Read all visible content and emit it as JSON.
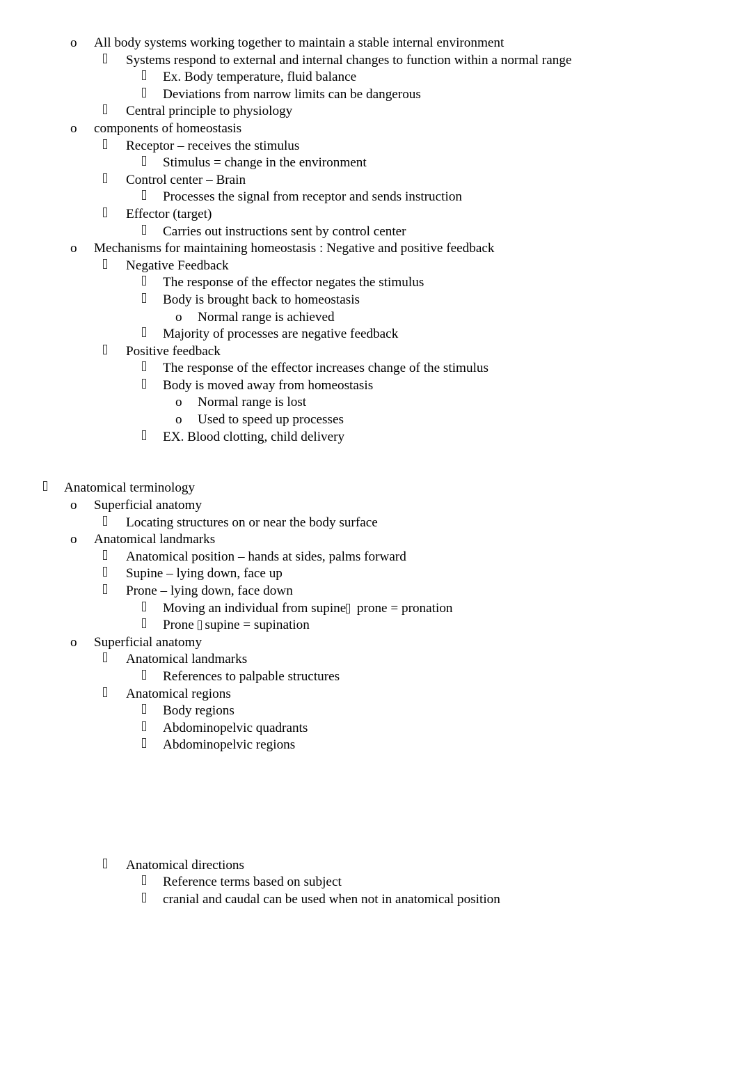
{
  "document": {
    "title": "Anatomy Notes — Homeostasis and Anatomical Terminology",
    "bullet_glyphs": {
      "level_o": "o",
      "level_tofu": "missing-glyph-box"
    },
    "colors": {
      "text": "#000000",
      "page_background": "#ffffff",
      "tofu_outline": "#3a3a3a"
    }
  },
  "blocks": [
    {
      "id": "homeostasis",
      "lines": [
        {
          "level": 1,
          "marker": "o",
          "text": "All body systems working together to maintain a stable internal environment"
        },
        {
          "level": 2,
          "marker": "tofu",
          "text": "Systems respond to external and internal changes to function within a normal range"
        },
        {
          "level": 3,
          "marker": "tofu",
          "text": "Ex. Body temperature, fluid balance"
        },
        {
          "level": 3,
          "marker": "tofu",
          "text": "Deviations from narrow limits can be dangerous"
        },
        {
          "level": 2,
          "marker": "tofu",
          "text": "Central principle to physiology"
        },
        {
          "level": 1,
          "marker": "o",
          "text": "components of homeostasis"
        },
        {
          "level": 2,
          "marker": "tofu",
          "text": "Receptor – receives the stimulus"
        },
        {
          "level": 3,
          "marker": "tofu",
          "text": "Stimulus = change in the environment"
        },
        {
          "level": 2,
          "marker": "tofu",
          "text": "Control center – Brain"
        },
        {
          "level": 3,
          "marker": "tofu",
          "text": "Processes the signal from receptor and sends instruction"
        },
        {
          "level": 2,
          "marker": "tofu",
          "text": "Effector (target)"
        },
        {
          "level": 3,
          "marker": "tofu",
          "text": "Carries out instructions sent by control center"
        },
        {
          "level": 1,
          "marker": "o",
          "text": "Mechanisms for maintaining homeostasis : Negative and positive feedback"
        },
        {
          "level": 2,
          "marker": "tofu",
          "text": "Negative Feedback"
        },
        {
          "level": 3,
          "marker": "tofu",
          "text": "The response of the effector negates the stimulus"
        },
        {
          "level": 3,
          "marker": "tofu",
          "text": "Body is brought back to homeostasis"
        },
        {
          "level": 4,
          "marker": "o",
          "text": "Normal range is achieved"
        },
        {
          "level": 3,
          "marker": "tofu",
          "text": "Majority of processes are negative feedback"
        },
        {
          "level": 2,
          "marker": "tofu",
          "text": "Positive feedback"
        },
        {
          "level": 3,
          "marker": "tofu",
          "text": "The response of the effector increases change of the stimulus"
        },
        {
          "level": 3,
          "marker": "tofu",
          "text": "Body is moved away from homeostasis"
        },
        {
          "level": 4,
          "marker": "o",
          "text": "Normal range is lost"
        },
        {
          "level": 4,
          "marker": "o",
          "text": "Used to speed up processes"
        },
        {
          "level": 3,
          "marker": "tofu",
          "text": "EX. Blood clotting, child delivery"
        }
      ]
    },
    {
      "id": "anatomical-terminology",
      "lines": [
        {
          "level": 0,
          "marker": "tofu",
          "text": "Anatomical terminology"
        },
        {
          "level": 1,
          "marker": "o",
          "text": "Superficial anatomy"
        },
        {
          "level": 2,
          "marker": "tofu",
          "text": "Locating structures on or near the body surface"
        },
        {
          "level": 1,
          "marker": "o",
          "text": "Anatomical landmarks"
        },
        {
          "level": 2,
          "marker": "tofu",
          "text": "Anatomical position – hands at sides, palms forward"
        },
        {
          "level": 2,
          "marker": "tofu",
          "text": "Supine – lying down, face up"
        },
        {
          "level": 2,
          "marker": "tofu",
          "text": "Prone – lying down, face down"
        },
        {
          "level": 3,
          "marker": "tofu",
          "text_parts": [
            "Moving an individual from supine",
            "TOFU",
            "  prone = pronation"
          ]
        },
        {
          "level": 3,
          "marker": "tofu",
          "text_parts": [
            "Prone ",
            "TOFU",
            " supine = supination"
          ]
        },
        {
          "level": 1,
          "marker": "o",
          "text": "Superficial anatomy"
        },
        {
          "level": 2,
          "marker": "tofu",
          "text": "Anatomical landmarks"
        },
        {
          "level": 3,
          "marker": "tofu",
          "text": "References to palpable structures"
        },
        {
          "level": 2,
          "marker": "tofu",
          "text": "Anatomical regions"
        },
        {
          "level": 3,
          "marker": "tofu",
          "text": "Body regions"
        },
        {
          "level": 3,
          "marker": "tofu",
          "text": "Abdominopelvic quadrants"
        },
        {
          "level": 3,
          "marker": "tofu",
          "text": "Abdominopelvic regions"
        }
      ]
    },
    {
      "id": "anatomical-directions",
      "lines": [
        {
          "level": 2,
          "marker": "tofu",
          "text": "Anatomical directions"
        },
        {
          "level": 3,
          "marker": "tofu",
          "text": "Reference terms based on subject"
        },
        {
          "level": 3,
          "marker": "tofu",
          "text": "cranial and caudal can be used when not in anatomical position"
        }
      ]
    }
  ],
  "gaps": {
    "after_homeostasis_lines": 2,
    "after_anatomical_terminology_lines": 6
  }
}
